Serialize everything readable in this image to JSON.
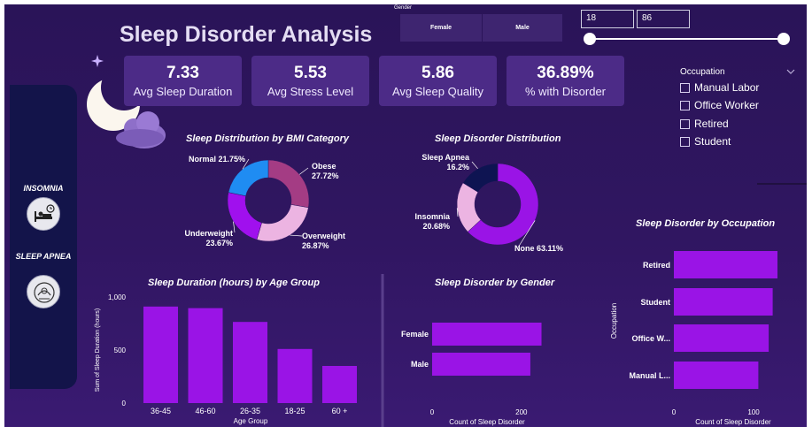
{
  "title": "Sleep Disorder Analysis",
  "gender_slicer": {
    "label": "Gender",
    "options": [
      "Female",
      "Male"
    ]
  },
  "age_slicer": {
    "min": "18",
    "max": "86"
  },
  "kpis": [
    {
      "value": "7.33",
      "label": "Avg Sleep Duration"
    },
    {
      "value": "5.53",
      "label": "Avg Stress Level"
    },
    {
      "value": "5.86",
      "label": "Avg Sleep Quality"
    },
    {
      "value": "36.89%",
      "label": "% with Disorder"
    }
  ],
  "occupation_slicer": {
    "label": "Occupation",
    "options": [
      "Manual Labor",
      "Office Worker",
      "Retired",
      "Student"
    ]
  },
  "sidebar": {
    "items": [
      {
        "label": "INSOMNIA"
      },
      {
        "label": "SLEEP APNEA"
      }
    ]
  },
  "colors": {
    "background": "#2f1660",
    "bar": "#9a14e6",
    "kpi": "#4c2b87",
    "sidebar": "#13144a"
  },
  "icons": [
    "moon-cloud-icon",
    "sparkle-icon",
    "insomnia-icon",
    "sleep-apnea-icon",
    "chevron-down-icon"
  ],
  "chart_data": [
    {
      "type": "pie",
      "title": "Sleep Distribution by BMI Category",
      "slices": [
        {
          "label": "Obese",
          "value": 27.72,
          "display": "27.72%",
          "color": "#a43c84"
        },
        {
          "label": "Overweight",
          "value": 26.87,
          "display": "26.87%",
          "color": "#ecb4e2"
        },
        {
          "label": "Underweight",
          "value": 23.67,
          "display": "23.67%",
          "color": "#a010ee"
        },
        {
          "label": "Normal",
          "value": 21.75,
          "display": "21.75%",
          "color": "#1f8cf2"
        }
      ]
    },
    {
      "type": "pie",
      "title": "Sleep Disorder Distribution",
      "slices": [
        {
          "label": "None",
          "value": 63.11,
          "display": "63.11%",
          "color": "#9a14e6"
        },
        {
          "label": "Insomnia",
          "value": 20.68,
          "display": "20.68%",
          "color": "#ecb4e2"
        },
        {
          "label": "Sleep Apnea",
          "value": 16.2,
          "display": "16.2%",
          "color": "#0e1452"
        }
      ]
    },
    {
      "type": "bar",
      "title": "Sleep Duration (hours) by Age Group",
      "categories": [
        "36-45",
        "46-60",
        "26-35",
        "18-25",
        "60 +"
      ],
      "values": [
        910,
        895,
        765,
        510,
        350
      ],
      "xlabel": "Age Group",
      "ylabel": "Sum of Sleep Duration (hours)",
      "yticks": [
        "0",
        "500",
        "1,000"
      ],
      "ylim": [
        0,
        1000
      ]
    },
    {
      "type": "bar",
      "orientation": "horizontal",
      "title": "Sleep Disorder by Gender",
      "categories": [
        "Female",
        "Male"
      ],
      "values": [
        245,
        220
      ],
      "xlabel": "Count of Sleep Disorder",
      "xticks": [
        "0",
        "200"
      ],
      "xlim": [
        0,
        240
      ]
    },
    {
      "type": "bar",
      "orientation": "horizontal",
      "title": "Sleep Disorder by Occupation",
      "categories": [
        "Retired",
        "Student",
        "Office W...",
        "Manual L..."
      ],
      "values": [
        130,
        124,
        119,
        106
      ],
      "xlabel": "Count of Sleep Disorder",
      "ylabel": "Occupation",
      "xticks": [
        "0",
        "100"
      ],
      "xlim": [
        0,
        100
      ]
    }
  ]
}
